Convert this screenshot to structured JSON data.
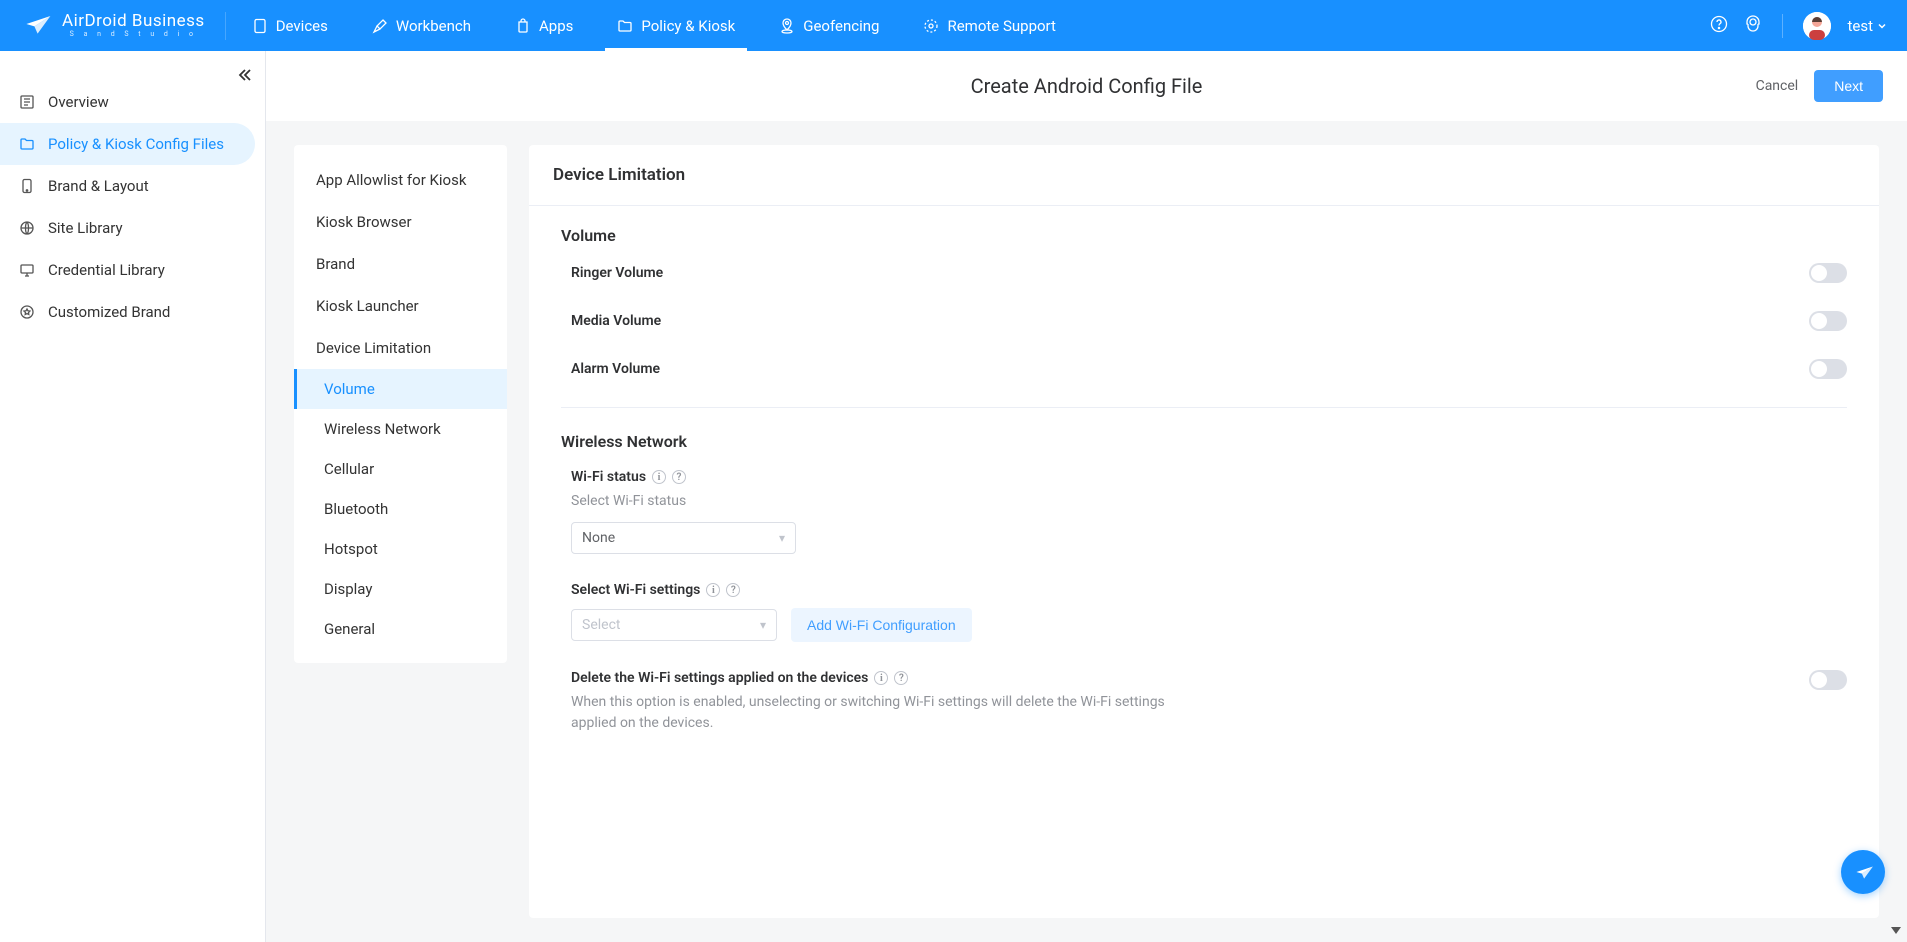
{
  "brand": {
    "name": "AirDroid Business",
    "sub": "S a n d   S t u d i o"
  },
  "nav": {
    "items": [
      {
        "label": "Devices"
      },
      {
        "label": "Workbench"
      },
      {
        "label": "Apps"
      },
      {
        "label": "Policy & Kiosk"
      },
      {
        "label": "Geofencing"
      },
      {
        "label": "Remote Support"
      }
    ]
  },
  "user": {
    "name": "test"
  },
  "sidebar": {
    "items": [
      {
        "label": "Overview"
      },
      {
        "label": "Policy & Kiosk Config Files"
      },
      {
        "label": "Brand & Layout"
      },
      {
        "label": "Site Library"
      },
      {
        "label": "Credential Library"
      },
      {
        "label": "Customized Brand"
      }
    ]
  },
  "page": {
    "title": "Create Android Config File",
    "cancel": "Cancel",
    "next": "Next"
  },
  "configNav": {
    "top": [
      {
        "label": "App Allowlist for Kiosk"
      },
      {
        "label": "Kiosk Browser"
      },
      {
        "label": "Brand"
      },
      {
        "label": "Kiosk Launcher"
      },
      {
        "label": "Device Limitation"
      }
    ],
    "sub": [
      {
        "label": "Volume"
      },
      {
        "label": "Wireless Network"
      },
      {
        "label": "Cellular"
      },
      {
        "label": "Bluetooth"
      },
      {
        "label": "Hotspot"
      },
      {
        "label": "Display"
      },
      {
        "label": "General"
      }
    ]
  },
  "panel": {
    "title": "Device Limitation",
    "volume": {
      "title": "Volume",
      "ringer": "Ringer Volume",
      "media": "Media Volume",
      "alarm": "Alarm Volume"
    },
    "wireless": {
      "title": "Wireless Network",
      "wifiStatusLabel": "Wi-Fi status",
      "wifiStatusSub": "Select Wi-Fi status",
      "wifiStatusValue": "None",
      "selectWifiLabel": "Select Wi-Fi settings",
      "selectWifiPlaceholder": "Select",
      "addWifiConfig": "Add Wi-Fi Configuration",
      "deleteWifiLabel": "Delete the Wi-Fi settings applied on the devices",
      "deleteWifiDesc": "When this option is enabled, unselecting or switching Wi-Fi settings will delete the Wi-Fi settings applied on the devices."
    }
  }
}
